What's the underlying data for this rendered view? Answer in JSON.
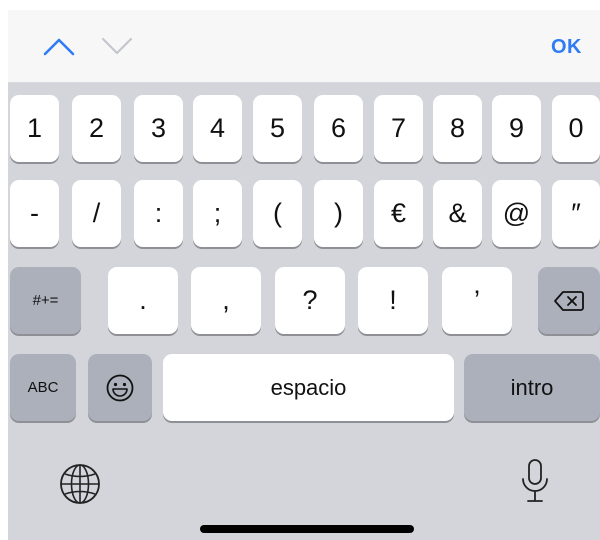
{
  "accessory": {
    "prev_icon": "chevron-up-icon",
    "next_icon": "chevron-down-icon",
    "ok_label": "OK",
    "accent": "#2f7cf6"
  },
  "keyboard": {
    "row1": [
      "1",
      "2",
      "3",
      "4",
      "5",
      "6",
      "7",
      "8",
      "9",
      "0"
    ],
    "row2": [
      "-",
      "/",
      ":",
      ";",
      "(",
      ")",
      "€",
      "&",
      "@",
      "″"
    ],
    "row3": {
      "shift_label": "#+=",
      "keys": [
        ".",
        ",",
        "?",
        "!",
        "’"
      ],
      "delete_icon": "backspace-icon"
    },
    "row4": {
      "abc_label": "ABC",
      "emoji_icon": "emoji-icon",
      "space_label": "espacio",
      "return_label": "intro"
    },
    "bottom": {
      "globe_icon": "globe-icon",
      "mic_icon": "microphone-icon"
    }
  }
}
